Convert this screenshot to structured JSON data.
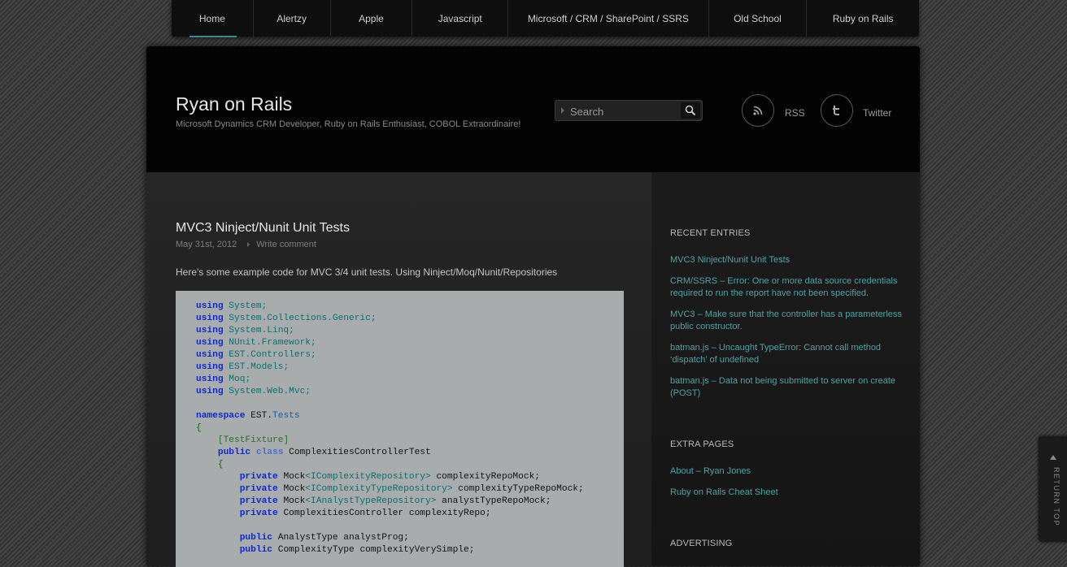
{
  "nav": {
    "items": [
      {
        "label": "Home",
        "active": true
      },
      {
        "label": "Alertzy"
      },
      {
        "label": "Apple"
      },
      {
        "label": "Javascript"
      },
      {
        "label": "Microsoft / CRM / SharePoint / SSRS"
      },
      {
        "label": "Old School"
      },
      {
        "label": "Ruby on Rails"
      }
    ]
  },
  "header": {
    "title": "Ryan on Rails",
    "tagline": "Microsoft Dynamics CRM Developer, Ruby on Rails Enthusiast, COBOL Extraordinaire!",
    "search_placeholder": "Search",
    "rss_label": "RSS",
    "twitter_label": "Twitter"
  },
  "post": {
    "title": "MVC3 Ninject/Nunit Unit Tests",
    "date": "May 31st, 2012",
    "comment_link": "Write comment",
    "intro": "Here's some example code for MVC 3/4 unit tests. Using Ninject/Moq/Nunit/Repositories",
    "code": {
      "l1": "System;",
      "l2": "System.Collections.Generic;",
      "l3": "System.Linq;",
      "l4": "NUnit.Framework;",
      "l5": "EST.Controllers;",
      "l6": "EST.Models;",
      "l7": "Moq;",
      "l8": "System.Web.Mvc;",
      "kw_using": "using",
      "kw_namespace": "namespace",
      "ns_est": "EST.",
      "ns_tests": "Tests",
      "brace_open": "{",
      "attr": "[TestFixture]",
      "kw_public": "public",
      "kw_class": "class",
      "class_name": "ComplexitiesControllerTest",
      "kw_private": "private",
      "mock": "Mock",
      "i_complexity_repo": "<IComplexityRepository>",
      "f1": "complexityRepoMock;",
      "i_complexity_type_repo": "<IComplexityTypeRepository>",
      "f2": "complexityTypeRepoMock;",
      "i_analyst_type_repo": "<IAnalystTypeRepository>",
      "f3": "analystTypeRepoMock;",
      "f4": "ComplexitiesController complexityRepo;",
      "f5": "AnalystType analystProg;",
      "f6": "ComplexityType complexityVerySimple;"
    }
  },
  "sidebar": {
    "recent_heading": "RECENT ENTRIES",
    "recent": [
      "MVC3 Ninject/Nunit Unit Tests",
      "CRM/SSRS – Error: One or more data source credentials required to run the report have not been specified.",
      "MVC3 – Make sure that the controller has a parameterless public constructor.",
      "batman.js – Uncaught TypeError: Cannot call method ‘dispatch’ of undefined",
      "batman.js – Data not being submitted to server on create (POST)"
    ],
    "pages_heading": "EXTRA PAGES",
    "pages": [
      "About – Ryan Jones",
      "Ruby on Rails Cheat Sheet"
    ],
    "advertising_heading": "ADVERTISING"
  },
  "return_top": "RETURN TOP",
  "colors": {
    "accent": "#3d8a8e",
    "link": "#4ea2a4",
    "code_bg": "#a8acad"
  },
  "icons": [
    "search-icon",
    "rss-icon",
    "twitter-icon",
    "arrow-up-icon"
  ]
}
